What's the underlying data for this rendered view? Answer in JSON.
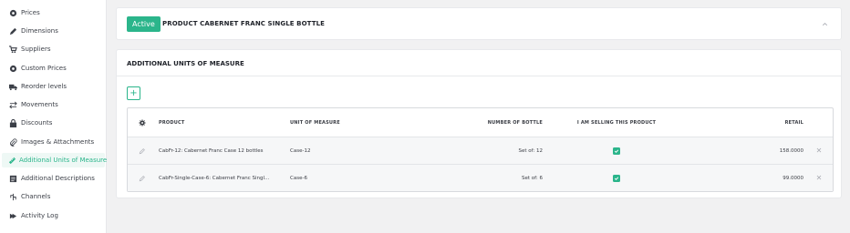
{
  "sidebar": {
    "items": [
      {
        "label": "Prices",
        "icon": "gear-icon"
      },
      {
        "label": "Dimensions",
        "icon": "pencil-icon"
      },
      {
        "label": "Suppliers",
        "icon": "cart-icon"
      },
      {
        "label": "Custom Prices",
        "icon": "gear-icon"
      },
      {
        "label": "Reorder levels",
        "icon": "truck-icon"
      },
      {
        "label": "Movements",
        "icon": "swap-icon"
      },
      {
        "label": "Discounts",
        "icon": "lock-icon"
      },
      {
        "label": "Images & Attachments",
        "icon": "paperclip-icon"
      },
      {
        "label": "Additional Units of Measure",
        "icon": "ruler-icon"
      },
      {
        "label": "Additional Descriptions",
        "icon": "list-icon"
      },
      {
        "label": "Channels",
        "icon": "channels-icon"
      },
      {
        "label": "Activity Log",
        "icon": "arrow-right-icon"
      }
    ],
    "active_index": 8
  },
  "product": {
    "status": "Active",
    "title": "PRODUCT CABERNET FRANC SINGLE BOTTLE"
  },
  "units": {
    "section_title": "ADDITIONAL UNITS OF MEASURE",
    "add_label": "+",
    "columns": {
      "product": "PRODUCT",
      "uom": "UNIT OF MEASURE",
      "number": "NUMBER OF BOTTLE",
      "selling": "I AM SELLING THIS PRODUCT",
      "retail": "RETAIL"
    },
    "rows": [
      {
        "product": "CabFr-12: Cabernet Franc Case 12 bottles",
        "uom": "Case-12",
        "number": "Set of: 12",
        "selling": true,
        "retail": "158.0000"
      },
      {
        "product": "CabFr-Single-Case-6: Cabernet Franc Singl...",
        "uom": "Case-6",
        "number": "Set of: 6",
        "selling": true,
        "retail": "99.0000"
      }
    ]
  },
  "colors": {
    "accent": "#2bb58b",
    "background": "#f1f1f2"
  }
}
